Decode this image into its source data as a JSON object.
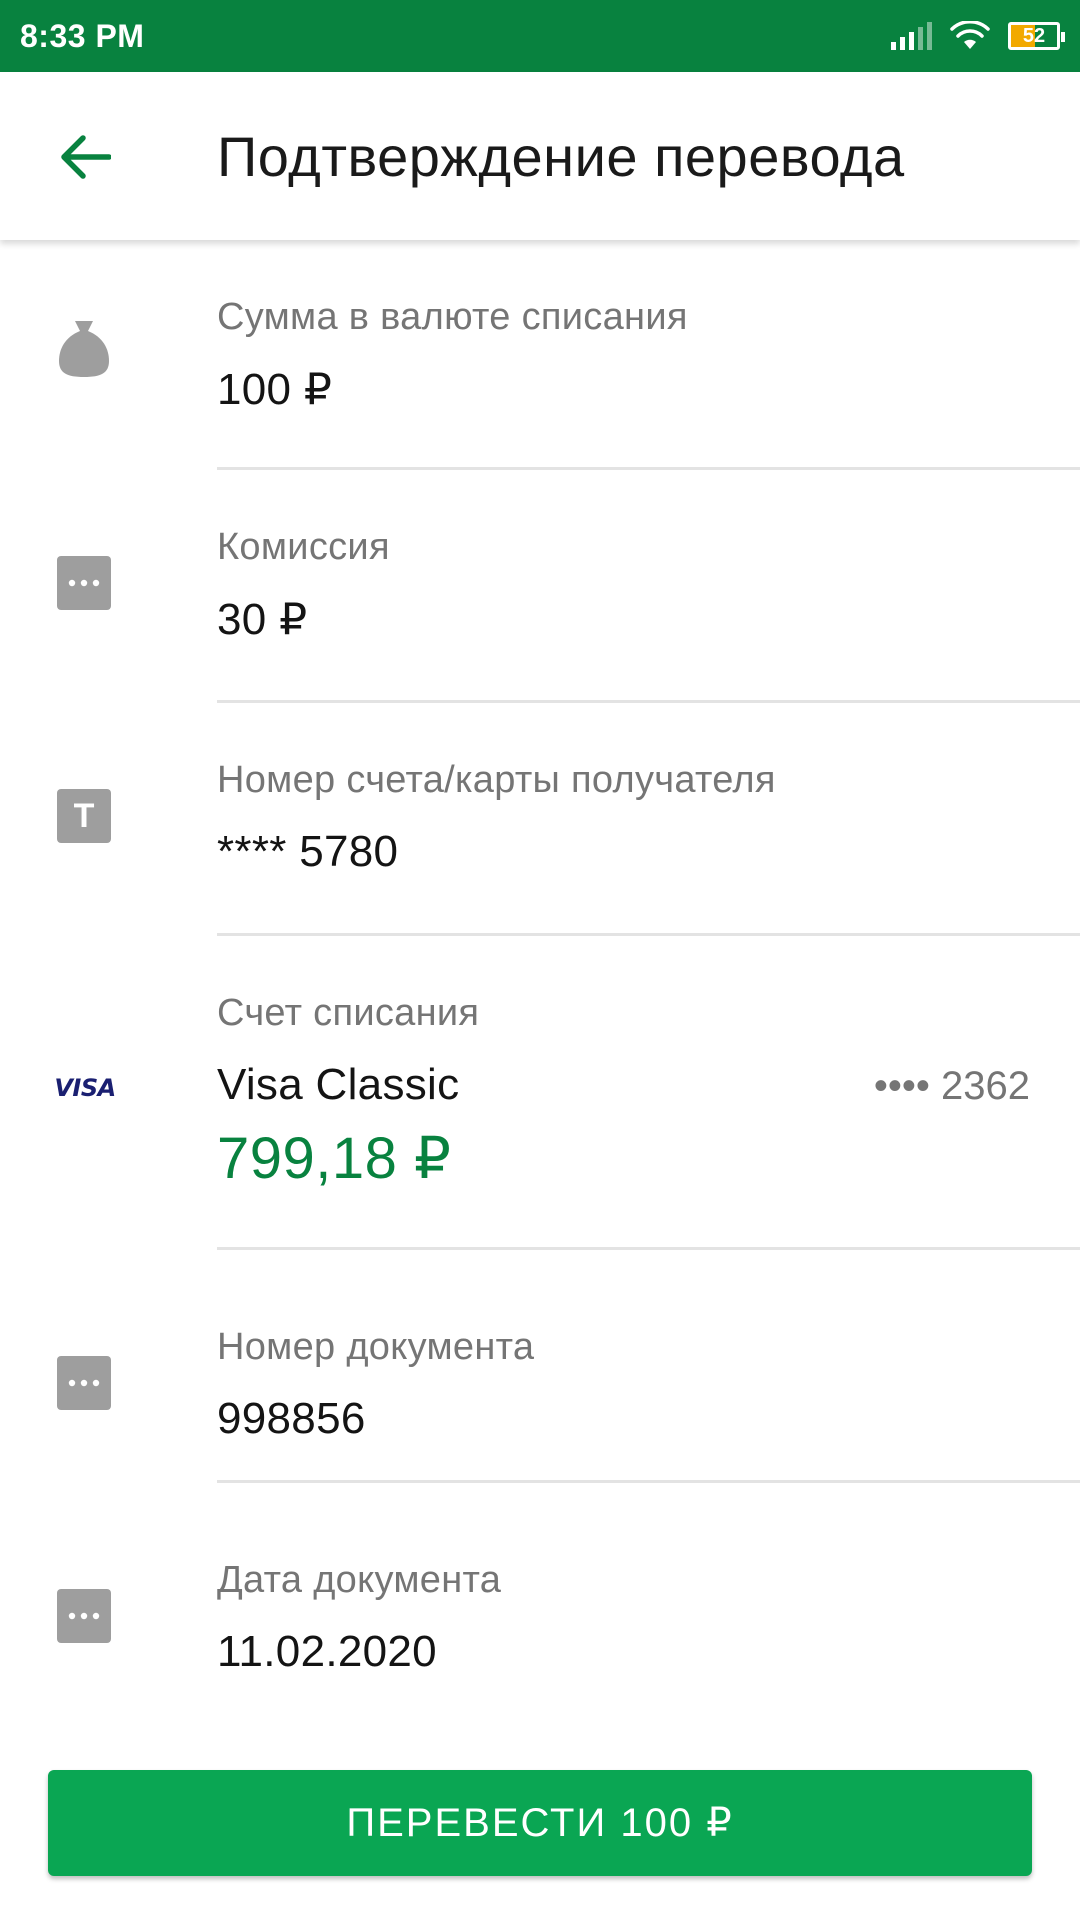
{
  "status_bar": {
    "time": "8:33 PM",
    "battery": "52",
    "battery_level": 0.52,
    "icons": [
      "signal-icon",
      "wifi-icon",
      "battery-icon"
    ]
  },
  "header": {
    "title": "Подтверждение перевода",
    "back_icon": "arrow-left-icon"
  },
  "rows": [
    {
      "icon": "money-bag-icon",
      "label": "Сумма в валюте списания",
      "value": "100 ₽"
    },
    {
      "icon": "more-icon",
      "label": "Комиссия",
      "value": "30 ₽"
    },
    {
      "icon": "text-t-icon",
      "icon_text": "T",
      "label": "Номер счета/карты получателя",
      "value": "**** 5780"
    },
    {
      "icon": "visa-logo-icon",
      "icon_text": "VISA",
      "label": "Счет списания",
      "value": "Visa Classic",
      "card_number": "•••• 2362",
      "balance": "799,18 ₽"
    },
    {
      "icon": "more-icon",
      "label": "Номер документа",
      "value": "998856"
    },
    {
      "icon": "more-icon",
      "label": "Дата документа",
      "value": "11.02.2020"
    }
  ],
  "action": {
    "label": "ПЕРЕВЕСТИ 100 ₽"
  },
  "colors": {
    "brand": "#08823f",
    "button": "#0aa653",
    "label": "#757575",
    "icon": "#9e9e9e"
  }
}
